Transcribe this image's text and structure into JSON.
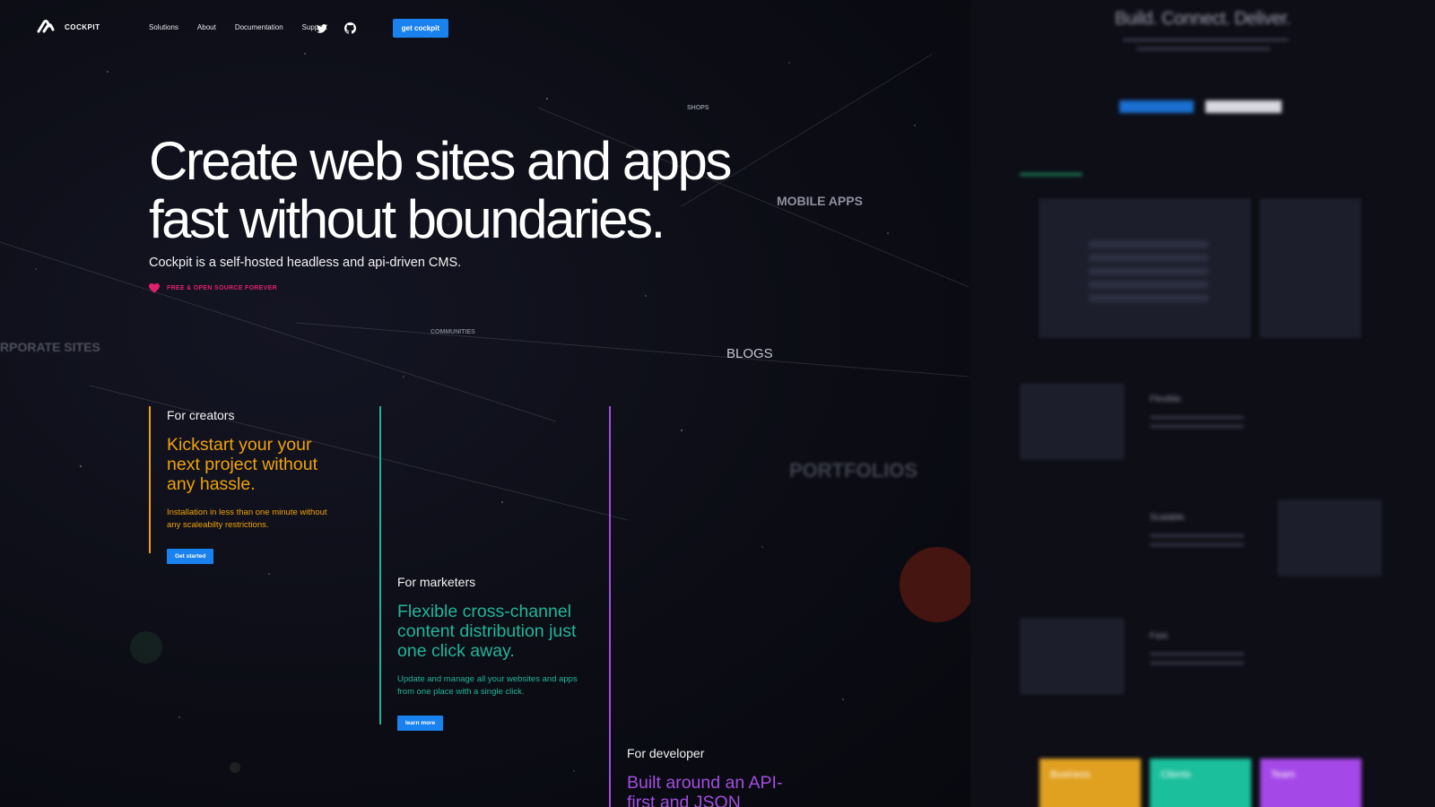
{
  "brand": {
    "name": "COCKPIT",
    "logo_icon": "cockpit-logo-icon"
  },
  "nav": {
    "items": [
      "Solutions",
      "About",
      "Documentation",
      "Support"
    ],
    "cta": "get cockpit",
    "icons": [
      "twitter-icon",
      "github-icon"
    ]
  },
  "hero": {
    "title_line1": "Create web sites and apps",
    "title_line2": "fast without boundaries.",
    "subtitle": "Cockpit is a self-hosted headless and api-driven CMS.",
    "badge": "FREE & OPEN SOURCE FOREVER"
  },
  "floating_words": {
    "shops": "SHOPS",
    "mobile_apps": "MOBILE APPS",
    "corporate_sites": "RPORATE SITES",
    "communities": "COMMUNITIES",
    "blogs": "BLOGS",
    "portfolios": "PORTFOLIOS"
  },
  "columns": {
    "creators": {
      "kicker": "For creators",
      "headline": "Kickstart your your next project without any hassle.",
      "body": "Installation in less than one minute without any scaleabilty restrictions.",
      "button": "Get started",
      "color": "#f0a20a"
    },
    "marketers": {
      "kicker": "For marketers",
      "headline": "Flexible cross-channel content distribution just one click away.",
      "body": "Update and manage all your websites and apps from one place with a single click.",
      "button": "learn more",
      "color": "#22b59a"
    },
    "developer": {
      "kicker": "For developer",
      "headline": "Built around an API-first and JSON",
      "color": "#a24ee0"
    }
  },
  "preview": {
    "title": "Build. Connect. Deliver.",
    "sections": [
      "Flexible.",
      "Scalable.",
      "Fast."
    ],
    "cards": [
      "Business",
      "Clients",
      "Team"
    ],
    "card_colors": [
      "#e0a020",
      "#1bbf9c",
      "#a548e8"
    ]
  },
  "colors": {
    "accent": "#1a82ef",
    "badge": "#e0206a",
    "background": "#0a0b12"
  }
}
